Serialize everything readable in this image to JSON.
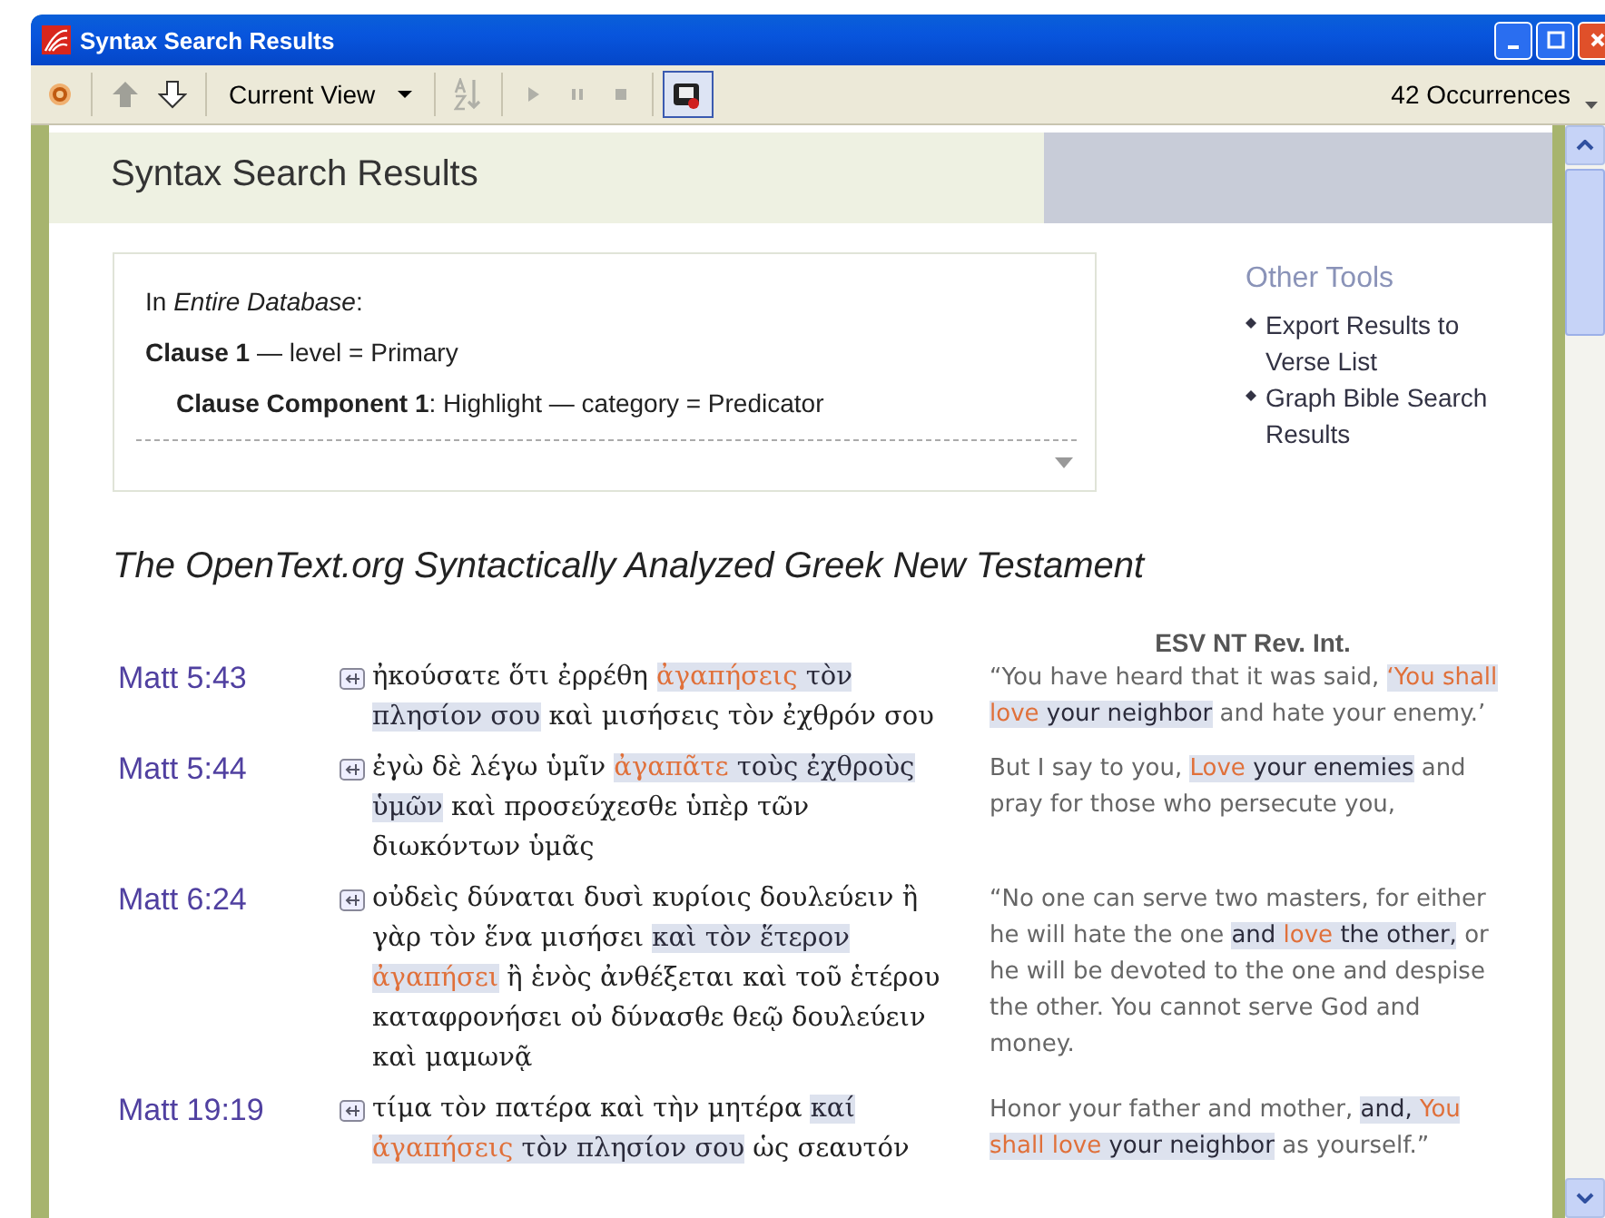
{
  "window": {
    "title": "Syntax Search Results"
  },
  "toolbar": {
    "items": [
      {
        "kind": "record",
        "disabled": false,
        "pressed": false
      },
      {
        "kind": "up",
        "disabled": true,
        "pressed": false
      },
      {
        "kind": "down",
        "disabled": false,
        "pressed": false
      },
      {
        "kind": "dropdown",
        "label": "Current View",
        "disabled": false,
        "pressed": false
      },
      {
        "kind": "sort",
        "disabled": true,
        "pressed": false
      },
      {
        "kind": "play",
        "disabled": true,
        "pressed": false
      },
      {
        "kind": "pause",
        "disabled": true,
        "pressed": false
      },
      {
        "kind": "stop",
        "disabled": true,
        "pressed": false
      },
      {
        "kind": "visual",
        "disabled": false,
        "pressed": true
      }
    ],
    "count": "42 Occurrences"
  },
  "page": {
    "title": "Syntax Search Results",
    "criteria": {
      "scope": "In *Entire Database*:",
      "clauses": [
        {
          "text": "**Clause 1** — level = Primary",
          "children": [
            {
              "text": "**Clause Component 1**: Highlight — category = Predicator"
            }
          ]
        }
      ]
    },
    "other_tools": {
      "title": "Other Tools",
      "links": [
        "Export Results to Verse List",
        "Graph Bible Search Results"
      ]
    },
    "resource_title": "The OpenText.org Syntactically Analyzed Greek New Testament",
    "translation_heading": "ESV NT Rev. Int.",
    "results": [
      {
        "reference": "Matt 5:43",
        "greek": [
          {
            "kind": "plain",
            "text": "ἠκούσατε ὅτι ἐρρέθη "
          },
          {
            "kind": "predicator",
            "text": "ἀγαπήσεις"
          },
          {
            "kind": "clause",
            "text": " τὸν πλησίον σου"
          },
          {
            "kind": "plain",
            "text": " καὶ μισήσεις τὸν ἐχθρόν σου"
          }
        ],
        "english": [
          {
            "kind": "plain",
            "text": "“You have heard that it was said, "
          },
          {
            "kind": "predicator",
            "text": "‘You shall love"
          },
          {
            "kind": "clause",
            "text": " your neighbor"
          },
          {
            "kind": "plain",
            "text": " and hate your enemy.’"
          }
        ]
      },
      {
        "reference": "Matt 5:44",
        "greek": [
          {
            "kind": "plain",
            "text": "ἐγὼ δὲ λέγω ὑμῖν "
          },
          {
            "kind": "predicator",
            "text": "ἀγαπᾶτε"
          },
          {
            "kind": "clause",
            "text": " τοὺς ἐχθροὺς ὑμῶν"
          },
          {
            "kind": "plain",
            "text": " καὶ προσεύχεσθε ὑπὲρ τῶν διωκόντων ὑμᾶς"
          }
        ],
        "english": [
          {
            "kind": "plain",
            "text": "But I say to you, "
          },
          {
            "kind": "predicator",
            "text": "Love"
          },
          {
            "kind": "clause",
            "text": " your enemies"
          },
          {
            "kind": "plain",
            "text": " and pray for those who persecute you,"
          }
        ]
      },
      {
        "reference": "Matt 6:24",
        "greek": [
          {
            "kind": "plain",
            "text": "οὐδεὶς δύναται δυσὶ κυρίοις δουλεύειν ἢ γὰρ τὸν ἕνα μισήσει "
          },
          {
            "kind": "clause",
            "text": "καὶ τὸν ἕτερον "
          },
          {
            "kind": "predicator",
            "text": "ἀγαπήσει"
          },
          {
            "kind": "plain",
            "text": " ἢ ἑνὸς ἀνθέξεται καὶ τοῦ ἑτέρου καταφρονήσει οὐ δύνασθε θεῷ δουλεύειν καὶ μαμωνᾷ"
          }
        ],
        "english": [
          {
            "kind": "plain",
            "text": "“No one can serve two masters, for either he will hate the one "
          },
          {
            "kind": "clause",
            "text": "and "
          },
          {
            "kind": "predicator",
            "text": "love"
          },
          {
            "kind": "clause",
            "text": " the other,"
          },
          {
            "kind": "plain",
            "text": " or he will be devoted to the one and despise the other. You cannot serve God and money."
          }
        ]
      },
      {
        "reference": "Matt 19:19",
        "greek": [
          {
            "kind": "plain",
            "text": "τίμα τὸν πατέρα καὶ τὴν μητέρα "
          },
          {
            "kind": "clause",
            "text": "καί "
          },
          {
            "kind": "predicator",
            "text": "ἀγαπήσεις"
          },
          {
            "kind": "clause",
            "text": " τὸν πλησίον σου"
          },
          {
            "kind": "plain",
            "text": " ὡς σεαυτόν"
          }
        ],
        "english": [
          {
            "kind": "plain",
            "text": "Honor your father and mother, "
          },
          {
            "kind": "clause",
            "text": "and, "
          },
          {
            "kind": "predicator",
            "text": "You shall love"
          },
          {
            "kind": "clause",
            "text": " your neighbor"
          },
          {
            "kind": "plain",
            "text": " as yourself.”"
          }
        ]
      }
    ]
  }
}
